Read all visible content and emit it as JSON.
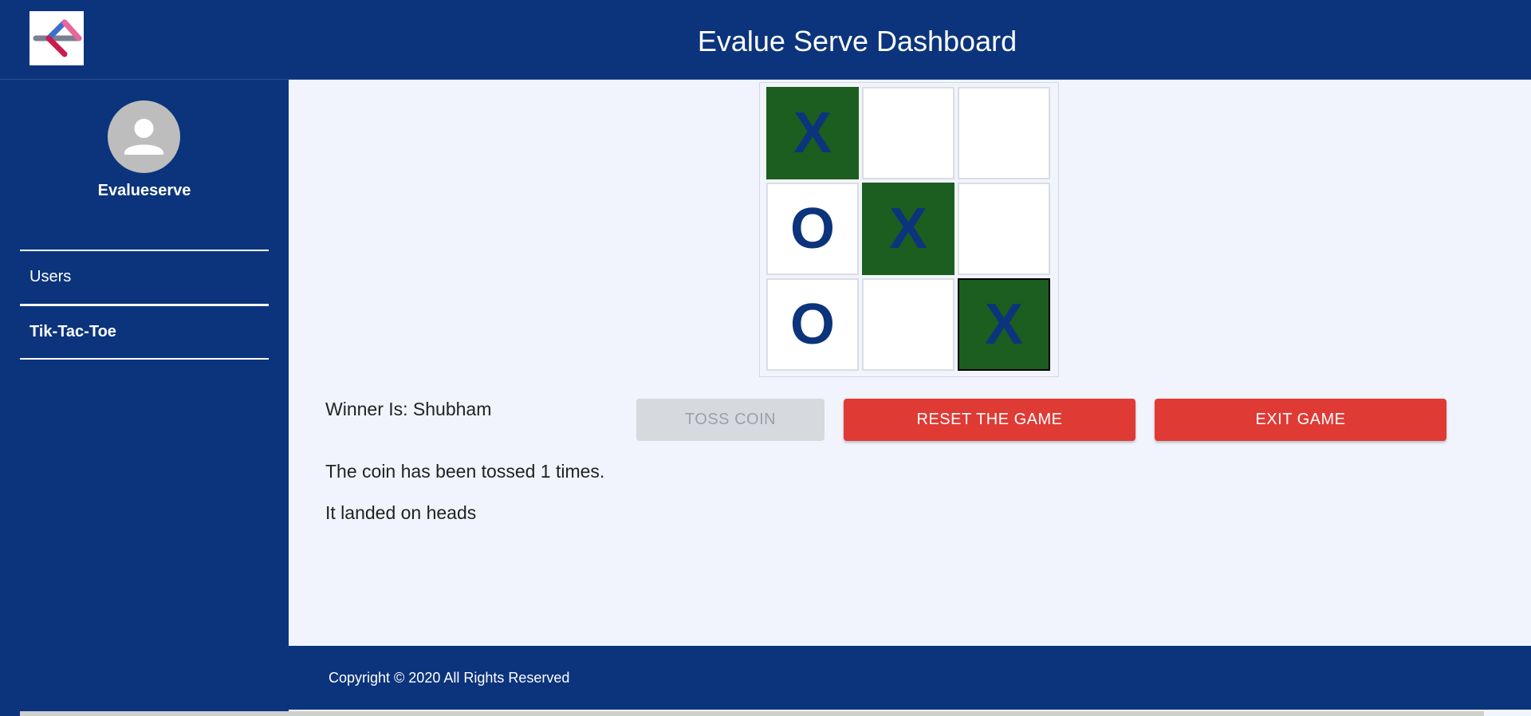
{
  "header": {
    "title": "Evalue Serve Dashboard",
    "logo_icon": "evalueserve-logo-icon"
  },
  "sidebar": {
    "username": "Evalueserve",
    "avatar_icon": "user-avatar-icon",
    "items": [
      {
        "label": "Users"
      },
      {
        "label": "Tik-Tac-Toe"
      }
    ]
  },
  "board": {
    "cells": [
      "X",
      "",
      "",
      "O",
      "X",
      "",
      "O",
      "",
      "X"
    ],
    "winning_color": "#1b5e20",
    "mark_color": "#0c347c"
  },
  "game": {
    "winner_text": "Winner Is: Shubham",
    "toss_button": "TOSS COIN",
    "reset_button": "RESET THE GAME",
    "exit_button": "EXIT GAME",
    "toss_count_text": "The coin has been tossed 1 times.",
    "landed_text": "It landed on heads"
  },
  "footer": {
    "copyright": "Copyright © 2020 All Rights Reserved"
  },
  "colors": {
    "primary": "#0c347c",
    "danger": "#e03a35",
    "background": "#f1f4fc"
  }
}
